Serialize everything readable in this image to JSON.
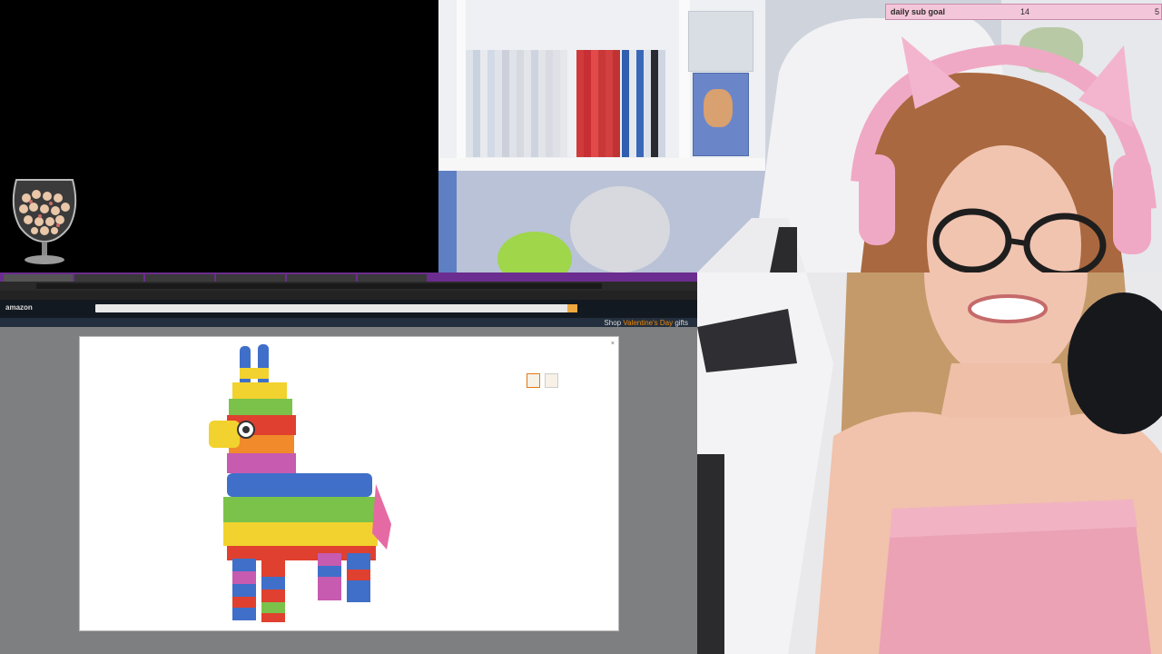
{
  "overlay": {
    "subgoal": {
      "label": "daily sub goal",
      "current": "14",
      "target": "5",
      "progress": 1.0
    }
  },
  "browser": {
    "tabs": [
      "",
      "",
      "",
      "",
      "",
      ""
    ],
    "amazon": {
      "logo": "amazon",
      "promo_prefix": "Shop",
      "promo_highlight": "Valentine's Day",
      "promo_suffix": "gifts"
    },
    "modal": {
      "close": "×"
    }
  },
  "colors": {
    "tabbar": "#6b2d8f",
    "amazon_header": "#131921",
    "amazon_nav": "#232f3e",
    "subgoal_bg": "#e7aac6",
    "subgoal_fill": "#f4c6d9"
  }
}
